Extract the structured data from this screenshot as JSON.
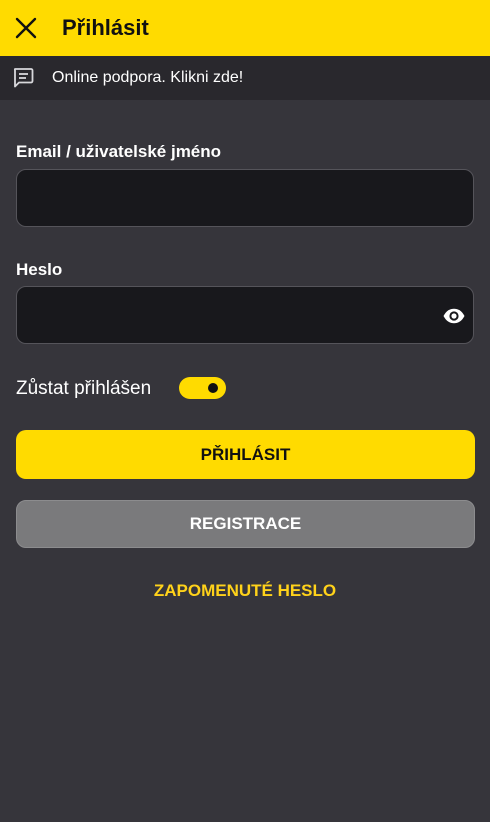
{
  "header": {
    "title": "Přihlásit",
    "close_icon": "close-icon"
  },
  "support": {
    "text": "Online podpora. Klikni zde!",
    "icon": "chat-icon"
  },
  "form": {
    "email_label": "Email / uživatelské jméno",
    "email_value": "",
    "password_label": "Heslo",
    "password_value": "",
    "password_toggle_icon": "eye-icon",
    "stay_logged_in_label": "Zůstat přihlášen",
    "stay_logged_in": true
  },
  "buttons": {
    "login": "PŘIHLÁSIT",
    "register": "REGISTRACE",
    "forgot_password": "ZAPOMENUTÉ HESLO"
  },
  "colors": {
    "accent": "#ffdb00",
    "background": "#36353b",
    "support_bar": "#29282d",
    "input_background": "#18181c",
    "register_button": "#7a7a7c"
  }
}
